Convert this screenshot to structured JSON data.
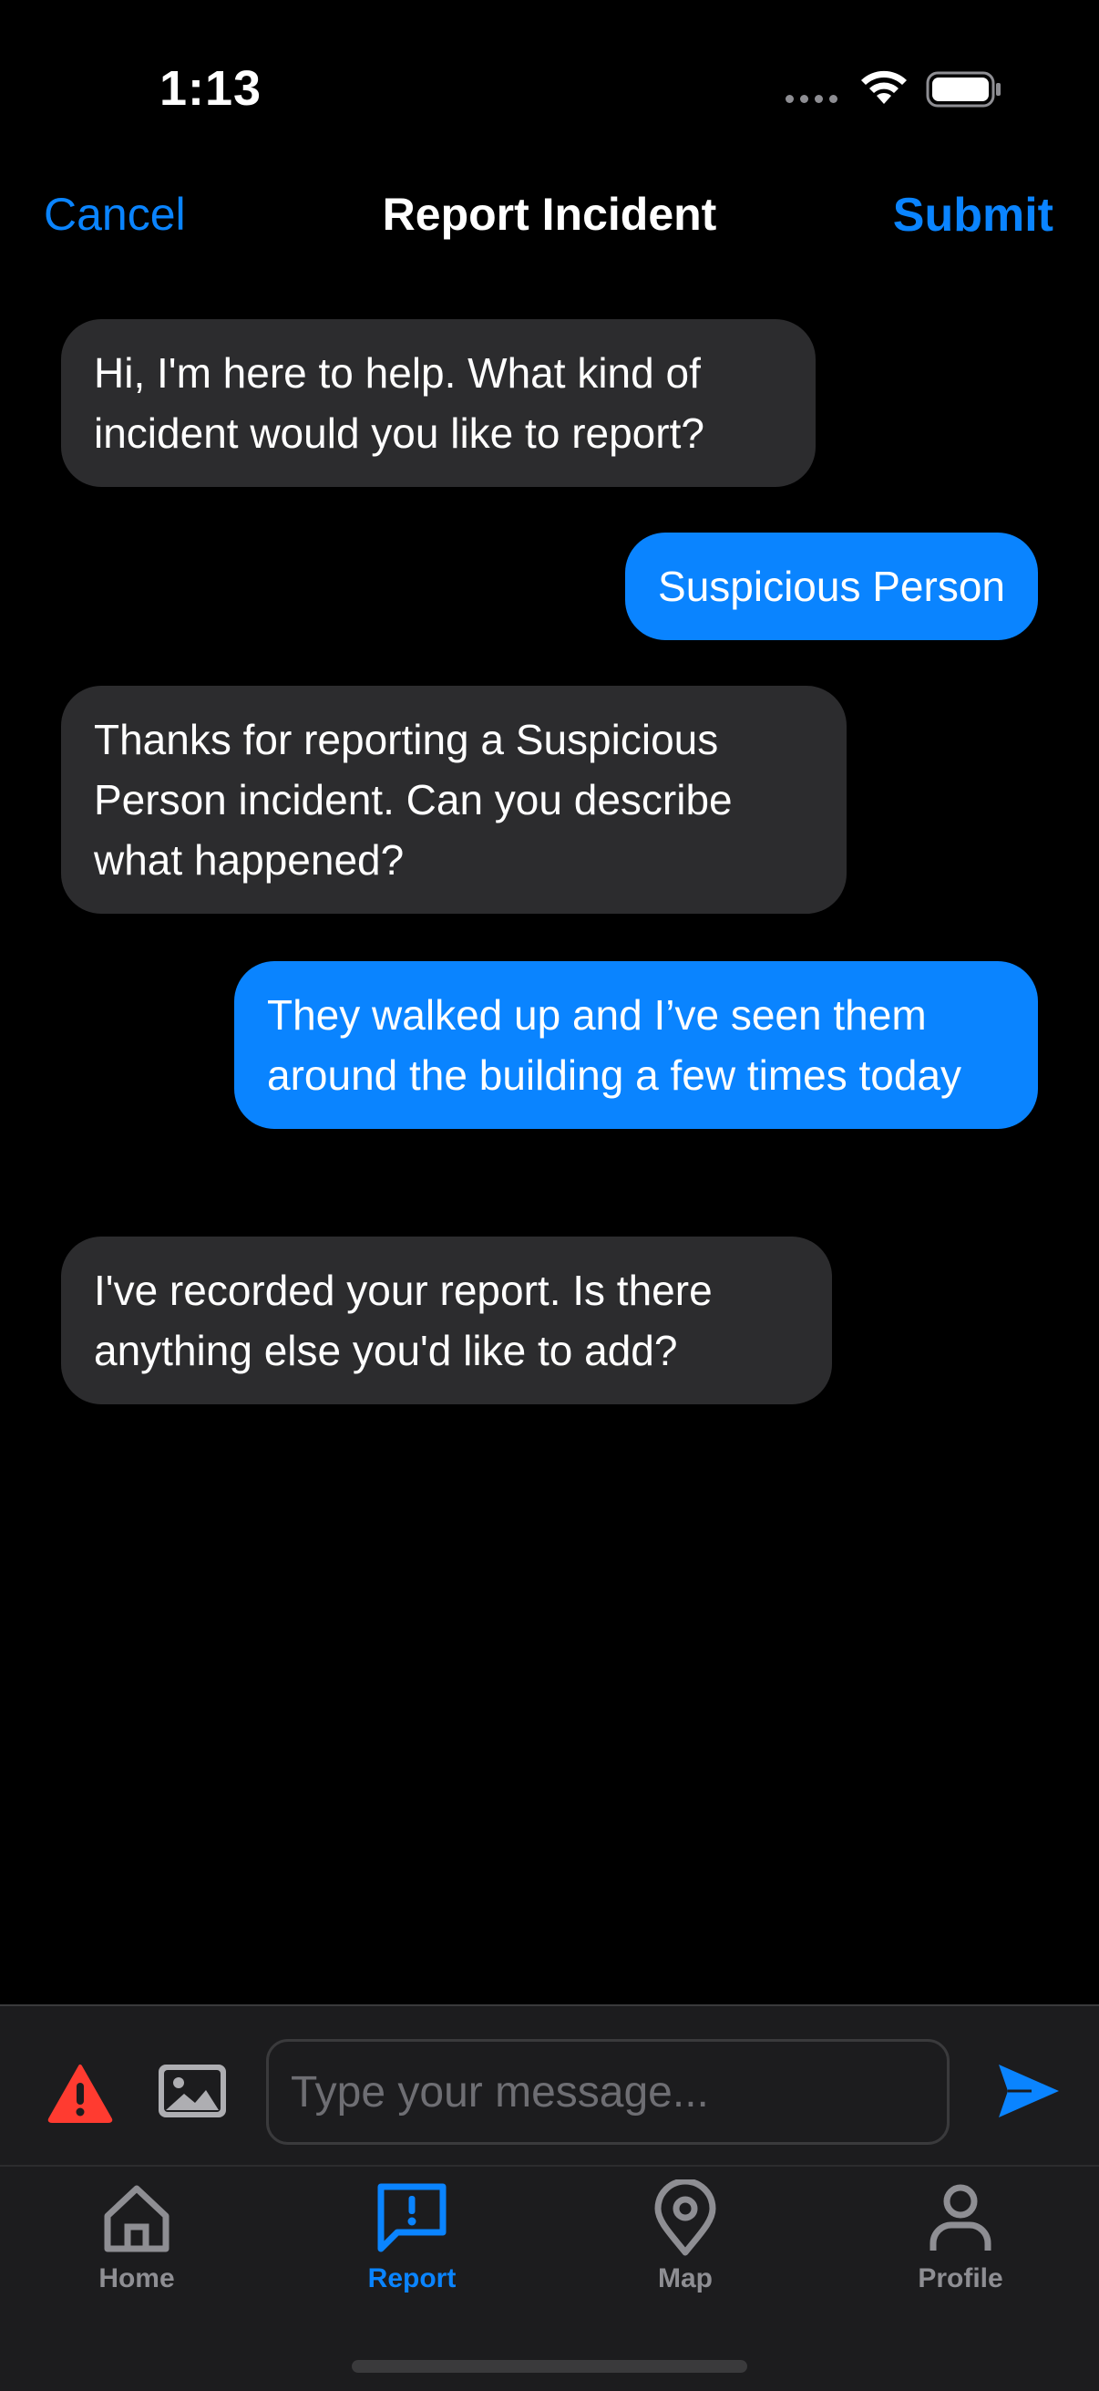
{
  "status_bar": {
    "time": "1:13"
  },
  "nav": {
    "cancel_label": "Cancel",
    "title": "Report Incident",
    "submit_label": "Submit"
  },
  "messages": [
    {
      "sender": "bot",
      "text": "Hi, I'm here to help. What kind of incident would you like to report?"
    },
    {
      "sender": "user",
      "text": "Suspicious Person"
    },
    {
      "sender": "bot",
      "text": "Thanks for reporting a Suspicious Person incident. Can you describe what happened?"
    },
    {
      "sender": "user",
      "text": "They walked up and I’ve seen them around the building a few times today"
    },
    {
      "sender": "bot",
      "text": "I've recorded your report. Is there anything else you'd like to add?"
    }
  ],
  "input": {
    "placeholder": "Type your message...",
    "value": ""
  },
  "tabs": [
    {
      "label": "Home",
      "icon": "house-icon",
      "active": false
    },
    {
      "label": "Report",
      "icon": "report-bubble-icon",
      "active": true
    },
    {
      "label": "Map",
      "icon": "map-pin-icon",
      "active": false
    },
    {
      "label": "Profile",
      "icon": "person-icon",
      "active": false
    }
  ],
  "colors": {
    "accent": "#0a84ff",
    "bot_bubble": "#2c2c2e",
    "alert": "#ff3b30",
    "background": "#000000"
  }
}
